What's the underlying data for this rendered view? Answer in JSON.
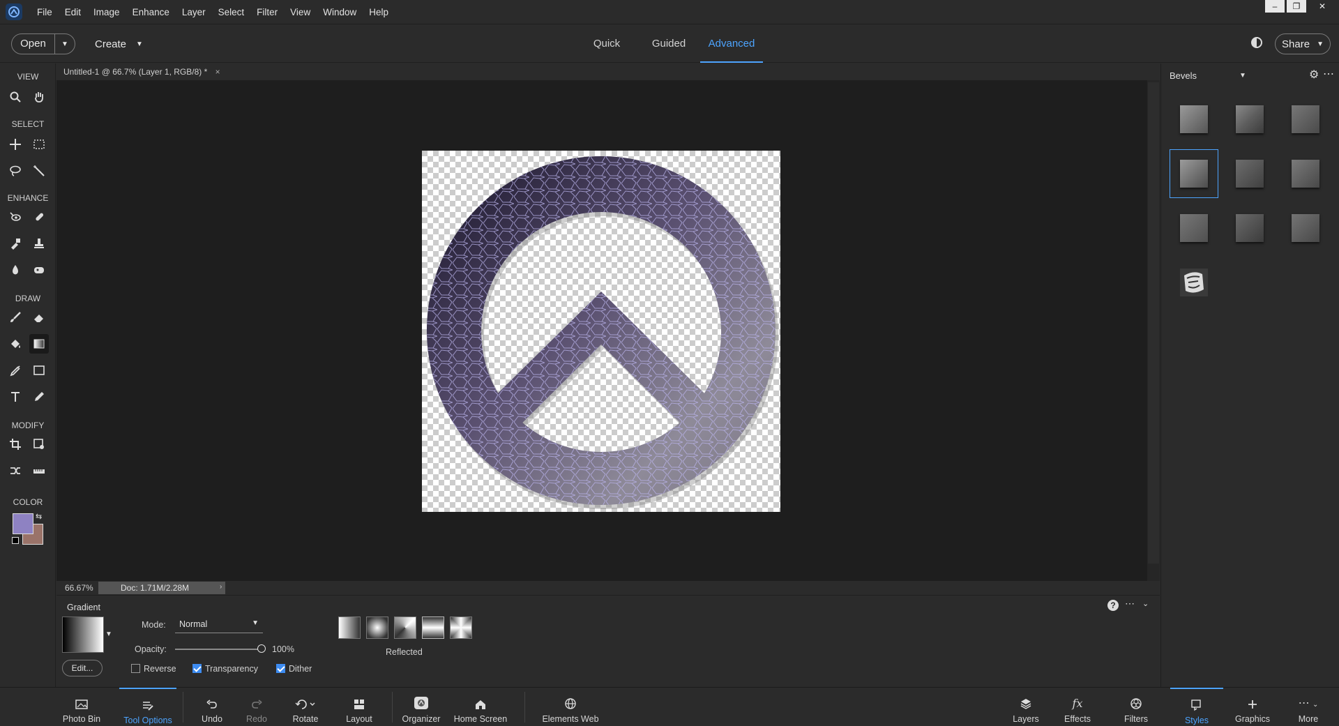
{
  "menu": [
    "File",
    "Edit",
    "Image",
    "Enhance",
    "Layer",
    "Select",
    "Filter",
    "View",
    "Window",
    "Help"
  ],
  "window_controls": [
    "–",
    "❐",
    "✕"
  ],
  "topbar": {
    "open_label": "Open",
    "create_label": "Create",
    "modes": [
      "Quick",
      "Guided",
      "Advanced"
    ],
    "active_mode": "Advanced",
    "share_label": "Share"
  },
  "toolbar": {
    "sections": [
      "VIEW",
      "SELECT",
      "ENHANCE",
      "DRAW",
      "MODIFY",
      "COLOR"
    ],
    "colors": {
      "foreground": "#8e82c2",
      "background": "#9a7369"
    }
  },
  "document": {
    "tab_title": "Untitled-1 @ 66.7% (Layer 1, RGB/8) *",
    "zoom": "66.67%",
    "doc_size": "Doc: 1.71M/2.28M"
  },
  "tool_options": {
    "tool_name": "Gradient",
    "mode_label": "Mode:",
    "mode_value": "Normal",
    "opacity_label": "Opacity:",
    "opacity_value": "100%",
    "edit_label": "Edit...",
    "reverse_label": "Reverse",
    "transparency_label": "Transparency",
    "dither_label": "Dither",
    "checks": {
      "reverse": false,
      "transparency": true,
      "dither": true
    },
    "gradient_types": [
      "Linear",
      "Radial",
      "Angle",
      "Reflected",
      "Diamond"
    ],
    "selected_type": "Reflected",
    "selected_type_label": "Reflected"
  },
  "right_panel": {
    "category": "Bevels",
    "selected_index": 3
  },
  "taskbar": {
    "left": [
      "Photo Bin",
      "Tool Options",
      "Undo",
      "Redo",
      "Rotate",
      "Layout",
      "Organizer",
      "Home Screen",
      "Elements Web"
    ],
    "right": [
      "Layers",
      "Effects",
      "Filters",
      "Styles",
      "Graphics",
      "More"
    ],
    "active_left": "Tool Options",
    "active_right": "Styles"
  }
}
